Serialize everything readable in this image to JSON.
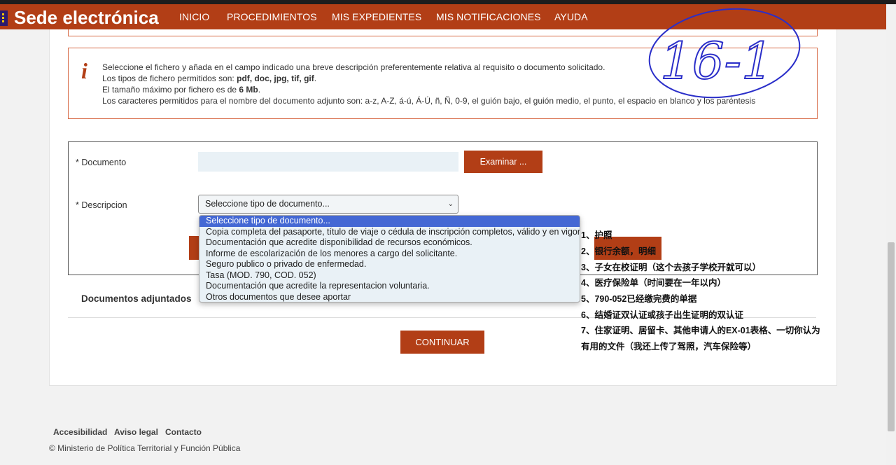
{
  "header": {
    "logo": "Sede electrónica",
    "nav": [
      "INICIO",
      "PROCEDIMIENTOS",
      "MIS EXPEDIENTES",
      "MIS NOTIFICACIONES",
      "AYUDA"
    ]
  },
  "info": {
    "icon": "info-icon",
    "line1": "Seleccione el fichero y añada en el campo indicado una breve descripción preferentemente relativa al requisito o documento solicitado.",
    "line2_prefix": "Los tipos de fichero permitidos son: ",
    "line2_types": "pdf, doc, jpg, tif, gif",
    "line2_suffix": ".",
    "line3_prefix": "El tamaño máximo por fichero es de ",
    "line3_size": "6 Mb",
    "line3_suffix": ".",
    "line4": "Los caracteres permitidos para el nombre del documento adjunto son: a-z, A-Z, á-ú, Á-Ú, ñ, Ñ, 0-9, el guión bajo, el guión medio, el punto, el espacio en blanco y los paréntesis"
  },
  "form": {
    "documento_label": "* Documento",
    "examinar_label": "Examinar ...",
    "descripcion_label": "* Descripcion",
    "select_value": "Seleccione tipo de documento...",
    "options": [
      "Seleccione tipo de documento...",
      "Copia completa del pasaporte, título de viaje o cédula de inscripción completos, válido y en vigor",
      "Documentación que acredite disponibilidad de recursos económicos.",
      "Informe de escolarización de los menores a cargo del solicitante.",
      "Seguro publico o privado de enfermedad.",
      "Tasa (MOD. 790, COD. 052)",
      "Documentación que acredite la representacion voluntaria.",
      "Otros documentos que desee aportar"
    ]
  },
  "docs_title": "Documentos adjuntados",
  "continuar_label": "CONTINUAR",
  "annotations": [
    "1、护照",
    "2、银行余额，明细",
    "3、子女在校证明（这个去孩子学校开就可以）",
    "4、医疗保险单（时间要在一年以内）",
    "5、790-052已经缴完费的单据",
    "6、结婚证双认证或孩子出生证明的双认证",
    "7、住家证明、居留卡、其他申请人的EX-01表格、一切你认为",
    "有用的文件（我还上传了驾照，汽车保险等）"
  ],
  "handwriting": "16-1",
  "footer": {
    "links": [
      "Accesibilidad",
      "Aviso legal",
      "Contacto"
    ],
    "copyright": "© Ministerio de Política Territorial y Función Pública"
  }
}
